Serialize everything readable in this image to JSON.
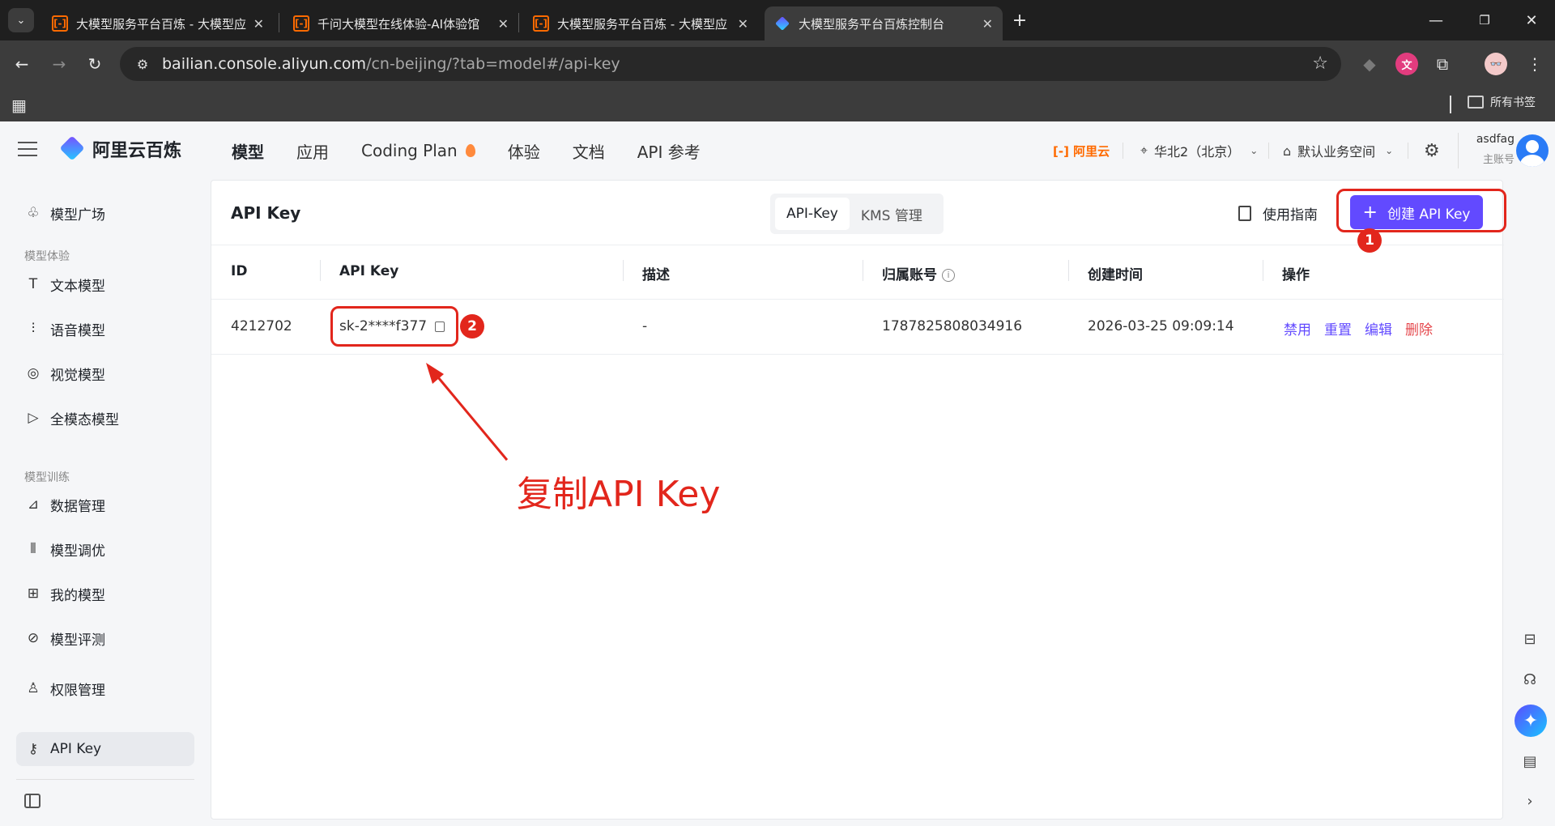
{
  "browser": {
    "tabs": [
      {
        "title": "大模型服务平台百炼 - 大模型应",
        "favicon": "aliyun-icon"
      },
      {
        "title": "千问大模型在线体验-AI体验馆",
        "favicon": "aliyun-icon"
      },
      {
        "title": "大模型服务平台百炼 - 大模型应",
        "favicon": "aliyun-icon"
      },
      {
        "title": "大模型服务平台百炼控制台",
        "favicon": "bailian-icon",
        "active": true
      }
    ],
    "url_host": "bailian.console.aliyun.com",
    "url_path": "/cn-beijing/?tab=model#/api-key",
    "bookmark_folder": "所有书签"
  },
  "header": {
    "brand": "阿里云百炼",
    "nav": [
      "模型",
      "应用",
      "Coding Plan",
      "体验",
      "文档",
      "API 参考"
    ],
    "aliyun": "阿里云",
    "region": "华北2（北京）",
    "workspace": "默认业务空间",
    "user_name": "asdfag",
    "user_role": "主账号"
  },
  "sidebar": {
    "items": [
      {
        "label": "模型广场",
        "icon": "model-square-icon"
      },
      {
        "section": "模型体验"
      },
      {
        "label": "文本模型",
        "icon": "text-icon"
      },
      {
        "label": "语音模型",
        "icon": "audio-wave-icon"
      },
      {
        "label": "视觉模型",
        "icon": "camera-icon"
      },
      {
        "label": "全模态模型",
        "icon": "video-icon"
      },
      {
        "section": "模型训练"
      },
      {
        "label": "数据管理",
        "icon": "chart-icon"
      },
      {
        "label": "模型调优",
        "icon": "sliders-icon"
      },
      {
        "label": "我的模型",
        "icon": "grid-icon"
      },
      {
        "label": "模型评测",
        "icon": "compass-icon"
      },
      {
        "label": "权限管理",
        "icon": "user-icon"
      },
      {
        "label": "API Key",
        "icon": "key-icon",
        "active": true
      }
    ]
  },
  "main": {
    "title": "API Key",
    "segments": [
      "API-Key",
      "KMS 管理"
    ],
    "guide_label": "使用指南",
    "create_label": "创建 API Key",
    "columns": [
      "ID",
      "API Key",
      "描述",
      "归属账号",
      "创建时间",
      "操作"
    ],
    "rows": [
      {
        "id": "4212702",
        "api_key": "sk-2****f377",
        "description": "-",
        "account": "1787825808034916",
        "created": "2026-03-25 09:09:14",
        "actions": [
          "禁用",
          "重置",
          "编辑",
          "删除"
        ]
      }
    ]
  },
  "annotations": {
    "badge_1": "1",
    "badge_2": "2",
    "caption": "复制API Key",
    "color": "#e2261c"
  },
  "colors": {
    "accent": "#624aff",
    "danger": "#e5484d",
    "chrome_dark": "#1f1f1f"
  }
}
